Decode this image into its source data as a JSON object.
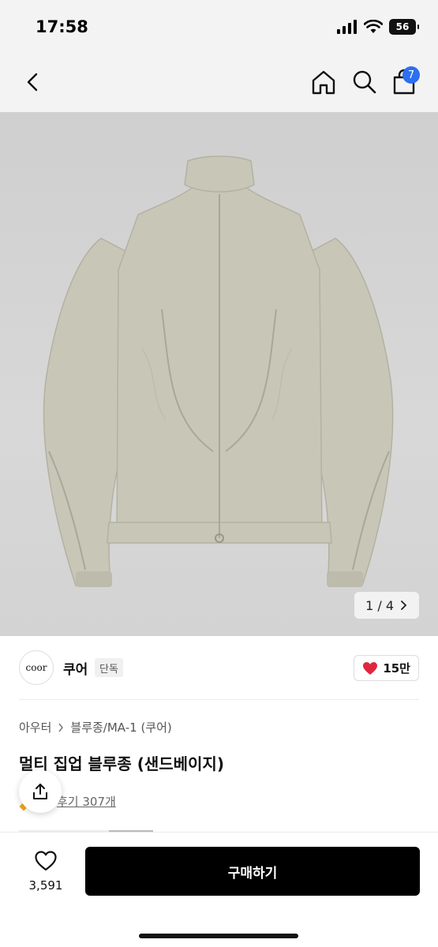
{
  "status": {
    "time": "17:58",
    "battery": "56"
  },
  "nav": {
    "cart_count": "7",
    "icons": [
      "back-icon",
      "home-icon",
      "search-icon",
      "cart-icon"
    ]
  },
  "gallery": {
    "counter": "1 / 4",
    "product_color": "#c8c6b7"
  },
  "brand": {
    "logo_text": "coor",
    "name": "쿠어",
    "tag": "단독",
    "likes": "15만",
    "like_color": "#e0263f"
  },
  "product": {
    "breadcrumb": [
      "아우터",
      "블루종/MA-1 (쿠어)"
    ],
    "title": "멀티 집업 블루종 (샌드베이지)",
    "review_text": "후기 307개"
  },
  "bottom": {
    "wish_count": "3,591",
    "buy_label": "구매하기"
  }
}
